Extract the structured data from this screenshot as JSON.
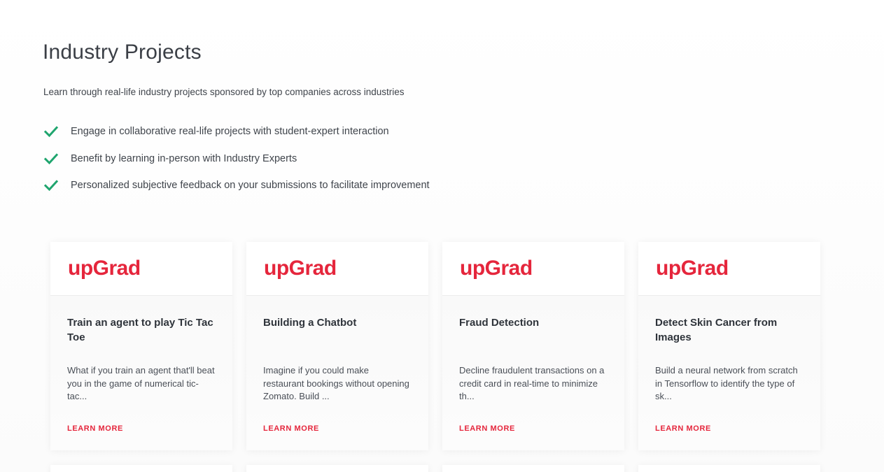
{
  "section": {
    "title": "Industry Projects",
    "subtitle": "Learn through real-life industry projects sponsored by top companies across industries"
  },
  "benefits": [
    {
      "icon": "check-icon",
      "text": "Engage in collaborative real-life projects with student-expert interaction"
    },
    {
      "icon": "check-icon",
      "text": "Benefit by learning in-person with Industry Experts"
    },
    {
      "icon": "check-icon",
      "text": "Personalized subjective feedback on your submissions to facilitate improvement"
    }
  ],
  "colors": {
    "accent": "#e5263c",
    "check": "#1fa56e",
    "text": "#3f444b"
  },
  "projects": [
    {
      "logo": "upGrad",
      "title": "Train an agent to play Tic Tac Toe",
      "description": "What if you train an agent that'll beat you in the game of numerical tic-tac...",
      "link": "LEARN MORE"
    },
    {
      "logo": "upGrad",
      "title": "Building a Chatbot",
      "description": "Imagine if you could make restaurant bookings without opening Zomato. Build ...",
      "link": "LEARN MORE"
    },
    {
      "logo": "upGrad",
      "title": "Fraud Detection",
      "description": "Decline fraudulent transactions on a credit card in real-time to minimize th...",
      "link": "LEARN MORE"
    },
    {
      "logo": "upGrad",
      "title": "Detect Skin Cancer from Images",
      "description": "Build a neural network from scratch in Tensorflow to identify the type of sk...",
      "link": "LEARN MORE"
    }
  ]
}
